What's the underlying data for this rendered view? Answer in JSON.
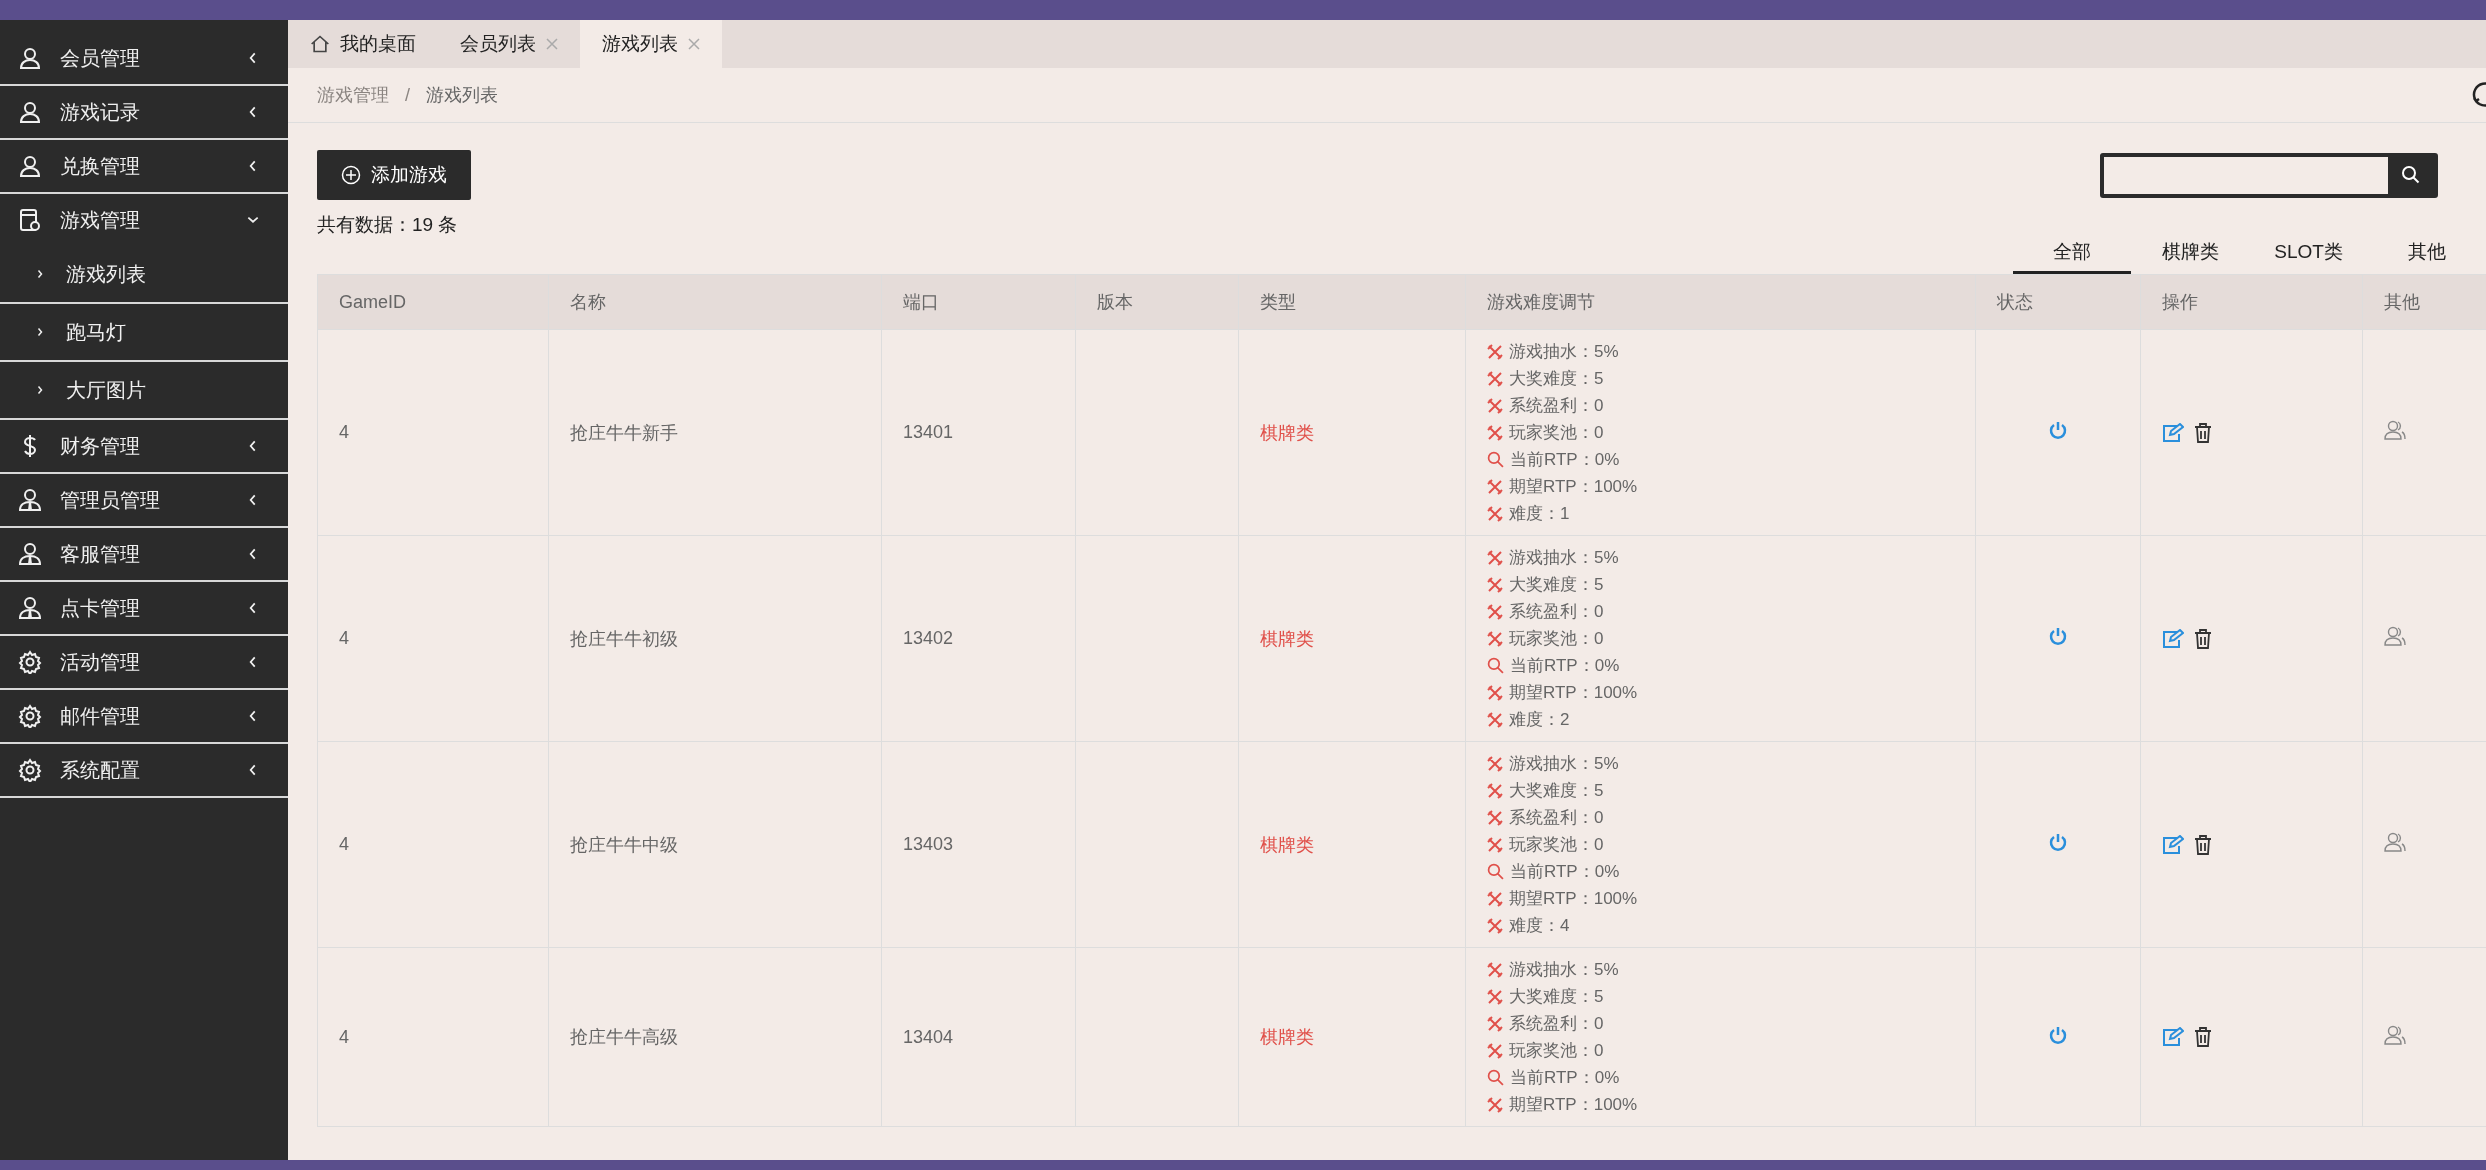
{
  "sidebar": {
    "items": [
      {
        "label": "会员管理",
        "kind": "user",
        "expanded": false
      },
      {
        "label": "游戏记录",
        "kind": "user",
        "expanded": false
      },
      {
        "label": "兑换管理",
        "kind": "user",
        "expanded": false
      },
      {
        "label": "游戏管理",
        "kind": "card",
        "expanded": true,
        "children": [
          {
            "label": "游戏列表"
          },
          {
            "label": "跑马灯"
          },
          {
            "label": "大厅图片"
          }
        ]
      },
      {
        "label": "财务管理",
        "kind": "dollar",
        "expanded": false
      },
      {
        "label": "管理员管理",
        "kind": "admin",
        "expanded": false
      },
      {
        "label": "客服管理",
        "kind": "admin",
        "expanded": false
      },
      {
        "label": "点卡管理",
        "kind": "admin",
        "expanded": false
      },
      {
        "label": "活动管理",
        "kind": "gear",
        "expanded": false
      },
      {
        "label": "邮件管理",
        "kind": "gear",
        "expanded": false
      },
      {
        "label": "系统配置",
        "kind": "gear",
        "expanded": false
      }
    ]
  },
  "tabs": [
    {
      "label": "我的桌面",
      "kind": "home",
      "selected": false
    },
    {
      "label": "会员列表",
      "kind": "closable",
      "selected": false
    },
    {
      "label": "游戏列表",
      "kind": "closable",
      "selected": true
    }
  ],
  "breadcrumb": [
    "游戏管理",
    "/",
    "游戏列表"
  ],
  "add_button": "添加游戏",
  "count_text": "共有数据：19 条",
  "filter_tabs": [
    {
      "label": "全部",
      "selected": true
    },
    {
      "label": "棋牌类",
      "selected": false
    },
    {
      "label": "SLOT类",
      "selected": false
    },
    {
      "label": "其他",
      "selected": false
    }
  ],
  "table": {
    "columns": [
      "GameID",
      "名称",
      "端口",
      "版本",
      "类型",
      "游戏难度调节",
      "状态",
      "操作",
      "其他"
    ],
    "rows": [
      {
        "id": "4",
        "name": "抢庄牛牛新手",
        "port": "13401",
        "type": "棋牌类",
        "settings": [
          {
            "kind": "tool",
            "text": "游戏抽水：5%"
          },
          {
            "kind": "tool",
            "text": "大奖难度：5"
          },
          {
            "kind": "tool",
            "text": "系统盈利：0"
          },
          {
            "kind": "tool",
            "text": "玩家奖池：0"
          },
          {
            "kind": "search",
            "text": "当前RTP：0%"
          },
          {
            "kind": "tool",
            "text": "期望RTP：100%"
          },
          {
            "kind": "tool",
            "text": "难度：1"
          }
        ]
      },
      {
        "id": "4",
        "name": "抢庄牛牛初级",
        "port": "13402",
        "type": "棋牌类",
        "settings": [
          {
            "kind": "tool",
            "text": "游戏抽水：5%"
          },
          {
            "kind": "tool",
            "text": "大奖难度：5"
          },
          {
            "kind": "tool",
            "text": "系统盈利：0"
          },
          {
            "kind": "tool",
            "text": "玩家奖池：0"
          },
          {
            "kind": "search",
            "text": "当前RTP：0%"
          },
          {
            "kind": "tool",
            "text": "期望RTP：100%"
          },
          {
            "kind": "tool",
            "text": "难度：2"
          }
        ]
      },
      {
        "id": "4",
        "name": "抢庄牛牛中级",
        "port": "13403",
        "type": "棋牌类",
        "settings": [
          {
            "kind": "tool",
            "text": "游戏抽水：5%"
          },
          {
            "kind": "tool",
            "text": "大奖难度：5"
          },
          {
            "kind": "tool",
            "text": "系统盈利：0"
          },
          {
            "kind": "tool",
            "text": "玩家奖池：0"
          },
          {
            "kind": "search",
            "text": "当前RTP：0%"
          },
          {
            "kind": "tool",
            "text": "期望RTP：100%"
          },
          {
            "kind": "tool",
            "text": "难度：4"
          }
        ]
      },
      {
        "id": "4",
        "name": "抢庄牛牛高级",
        "port": "13404",
        "type": "棋牌类",
        "settings": [
          {
            "kind": "tool",
            "text": "游戏抽水：5%"
          },
          {
            "kind": "tool",
            "text": "大奖难度：5"
          },
          {
            "kind": "tool",
            "text": "系统盈利：0"
          },
          {
            "kind": "tool",
            "text": "玩家奖池：0"
          },
          {
            "kind": "search",
            "text": "当前RTP：0%"
          },
          {
            "kind": "tool",
            "text": "期望RTP：100%"
          }
        ]
      }
    ]
  }
}
